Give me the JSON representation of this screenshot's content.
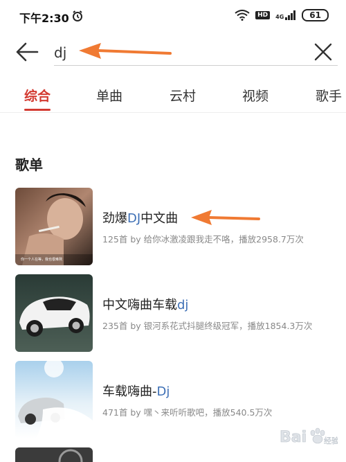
{
  "status": {
    "time": "下午2:30",
    "hd": "HD",
    "net": "4G",
    "battery": "61"
  },
  "search": {
    "query": "dj"
  },
  "tabs": [
    {
      "label": "综合",
      "active": true
    },
    {
      "label": "单曲"
    },
    {
      "label": "云村"
    },
    {
      "label": "视频"
    },
    {
      "label": "歌手"
    }
  ],
  "section": {
    "title": "歌单"
  },
  "playlists": [
    {
      "title_pre": "劲爆",
      "title_hl": "DJ",
      "title_post": "中文曲",
      "meta": "125首  by 给你冰激凌跟我走不咯，播放2958.7万次",
      "cover_caption": "你一个人在等，我也很难熬"
    },
    {
      "title_pre": "中文嗨曲车载",
      "title_hl": "dj",
      "title_post": "",
      "meta": "235首  by 银河系花式抖腿终级冠军，播放1854.3万次"
    },
    {
      "title_pre": "车载嗨曲-",
      "title_hl": "Dj",
      "title_post": "",
      "meta": "471首  by 嘿丶来听听歌吧，播放540.5万次"
    }
  ],
  "watermark": {
    "text": "Bai 经验"
  },
  "colors": {
    "accent": "#d33a31",
    "highlight": "#3d6fb5",
    "annotation": "#f07a33"
  }
}
